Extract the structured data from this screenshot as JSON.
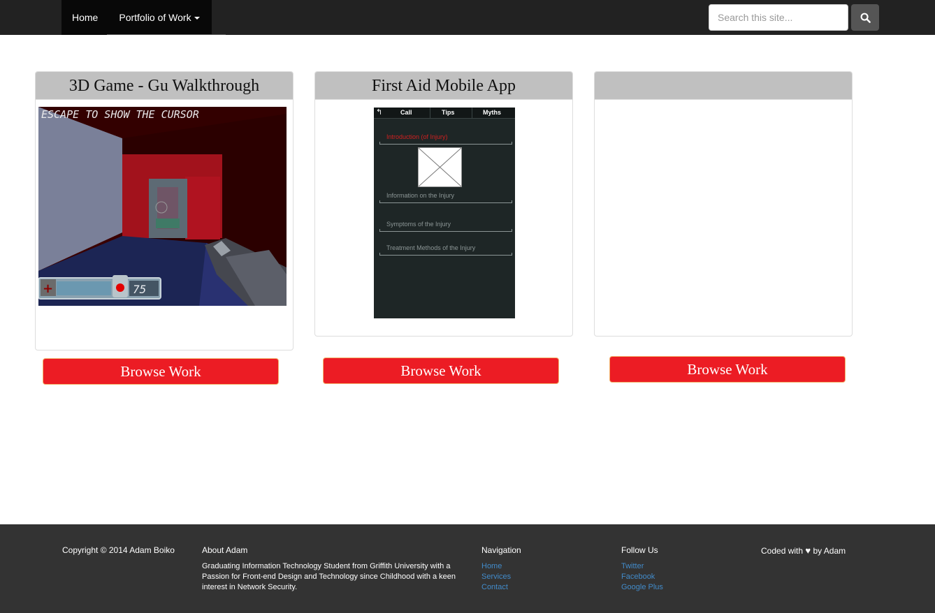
{
  "nav": {
    "home": "Home",
    "portfolio": "Portfolio of Work",
    "search_placeholder": "Search this site..."
  },
  "cards": [
    {
      "title": "3D Game - Gu Walkthrough",
      "button": "Browse Work",
      "game_overlay": "ESCAPE TO SHOW THE CURSOR",
      "game_ammo": "75"
    },
    {
      "title": "First Aid Mobile App",
      "button": "Browse Work",
      "app_tabs": [
        "Call",
        "Tips",
        "Myths"
      ],
      "app_sections": [
        "Introduction (of Injury)",
        "Information on the Injury",
        "Symptoms of the Injury",
        "Treatment Methods of the Injury"
      ]
    },
    {
      "title": "",
      "button": "Browse Work"
    }
  ],
  "footer": {
    "copyright": "Copyright © 2014 Adam Boiko",
    "about_title": "About Adam",
    "about_text": "Graduating Information Technology Student from Griffith University with a Passion for Front-end Design and Technology since Childhood with a keen interest in Network Security.",
    "nav_title": "Navigation",
    "nav_links": [
      "Home",
      "Services",
      "Contact"
    ],
    "follow_title": "Follow Us",
    "follow_links": [
      "Twitter",
      "Facebook",
      "Google Plus"
    ],
    "coded_prefix": "Coded with",
    "coded_suffix": "by Adam"
  },
  "colors": {
    "accent": "#ec1c24",
    "navbar": "#222222",
    "footer": "#333333",
    "link": "#428bca"
  }
}
